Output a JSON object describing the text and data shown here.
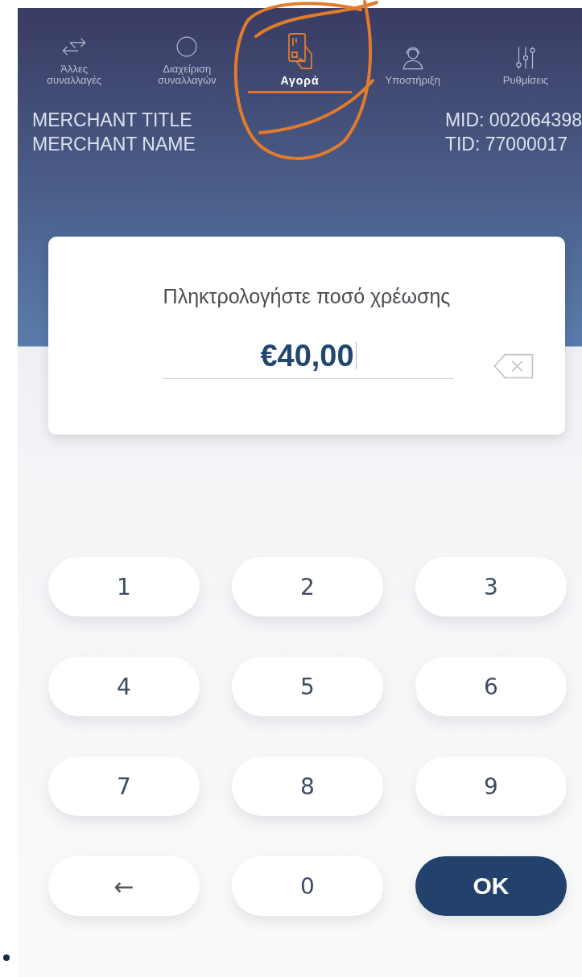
{
  "tabs": [
    {
      "label": "Άλλες\nσυναλλαγές",
      "kind": "arrows",
      "selected": false
    },
    {
      "label": "Διαχείριση\nσυναλλαγών",
      "kind": "circle",
      "selected": false
    },
    {
      "label": "Αγορά",
      "kind": "card",
      "selected": true
    },
    {
      "label": "Υποστήριξη",
      "kind": "person",
      "selected": false
    },
    {
      "label": "Ρυθμίσεις",
      "kind": "sliders",
      "selected": false
    }
  ],
  "merchant": {
    "title": "MERCHANT TITLE",
    "name": "MERCHANT NAME",
    "mid": "MID: 002064398",
    "tid": "TID: 77000017"
  },
  "amount_card": {
    "prompt": "Πληκτρολογήστε ποσό χρέωσης",
    "value": "€40,00"
  },
  "keypad": [
    {
      "kind": "digit",
      "label": "1"
    },
    {
      "kind": "digit",
      "label": "2"
    },
    {
      "kind": "digit",
      "label": "3"
    },
    {
      "kind": "digit",
      "label": "4"
    },
    {
      "kind": "digit",
      "label": "5"
    },
    {
      "kind": "digit",
      "label": "6"
    },
    {
      "kind": "digit",
      "label": "7"
    },
    {
      "kind": "digit",
      "label": "8"
    },
    {
      "kind": "digit",
      "label": "9"
    },
    {
      "kind": "back",
      "label": "←"
    },
    {
      "kind": "digit",
      "label": "0"
    },
    {
      "kind": "ok",
      "label": "OK"
    }
  ]
}
